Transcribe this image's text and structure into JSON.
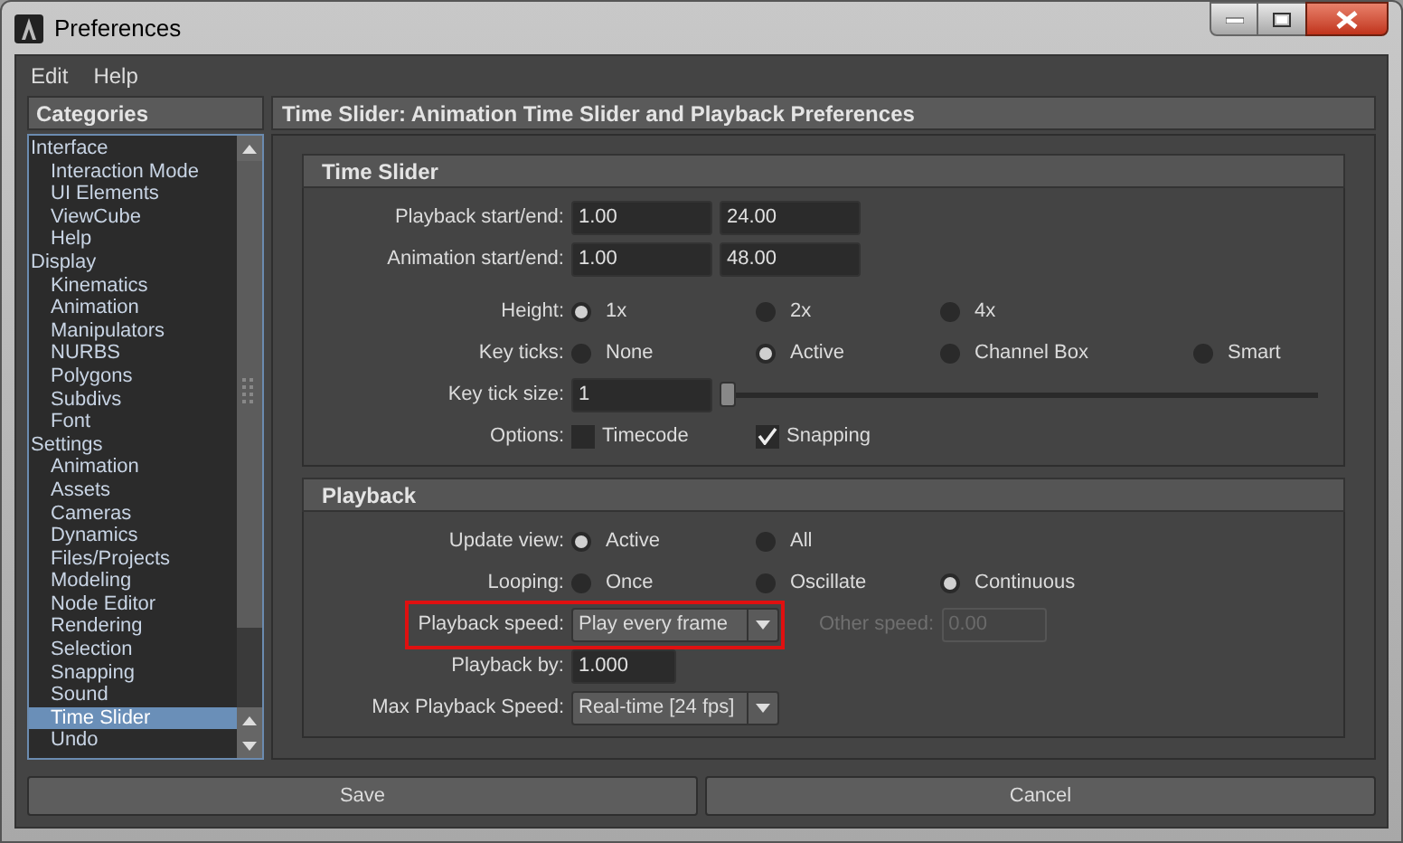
{
  "window": {
    "title": "Preferences"
  },
  "menu": [
    "Edit",
    "Help"
  ],
  "categories": {
    "title": "Categories",
    "items": [
      {
        "label": "Interface",
        "selected": false,
        "children": [
          {
            "label": "Interaction Mode",
            "selected": false
          },
          {
            "label": "UI Elements",
            "selected": false
          },
          {
            "label": "ViewCube",
            "selected": false
          },
          {
            "label": "Help",
            "selected": false
          }
        ]
      },
      {
        "label": "Display",
        "selected": false,
        "children": [
          {
            "label": "Kinematics",
            "selected": false
          },
          {
            "label": "Animation",
            "selected": false
          },
          {
            "label": "Manipulators",
            "selected": false
          },
          {
            "label": "NURBS",
            "selected": false
          },
          {
            "label": "Polygons",
            "selected": false
          },
          {
            "label": "Subdivs",
            "selected": false
          },
          {
            "label": "Font",
            "selected": false
          }
        ]
      },
      {
        "label": "Settings",
        "selected": false,
        "children": [
          {
            "label": "Animation",
            "selected": false
          },
          {
            "label": "Assets",
            "selected": false
          },
          {
            "label": "Cameras",
            "selected": false
          },
          {
            "label": "Dynamics",
            "selected": false
          },
          {
            "label": "Files/Projects",
            "selected": false
          },
          {
            "label": "Modeling",
            "selected": false
          },
          {
            "label": "Node Editor",
            "selected": false
          },
          {
            "label": "Rendering",
            "selected": false
          },
          {
            "label": "Selection",
            "selected": false
          },
          {
            "label": "Snapping",
            "selected": false
          },
          {
            "label": "Sound",
            "selected": false
          },
          {
            "label": "Time Slider",
            "selected": true
          },
          {
            "label": "Undo",
            "selected": false
          }
        ]
      }
    ]
  },
  "panel_title": "Time Slider: Animation Time Slider and Playback Preferences",
  "sections": [
    {
      "title": "Time Slider",
      "rows": [
        {
          "kind": "fields",
          "label": "Playback start/end:",
          "values": [
            "1.00",
            "24.00"
          ]
        },
        {
          "kind": "fields",
          "label": "Animation start/end:",
          "values": [
            "1.00",
            "48.00"
          ]
        },
        {
          "kind": "radio",
          "label": "Height:",
          "options": [
            {
              "label": "1x",
              "selected": true
            },
            {
              "label": "2x",
              "selected": false
            },
            {
              "label": "4x",
              "selected": false
            }
          ]
        },
        {
          "kind": "radio",
          "label": "Key ticks:",
          "options": [
            {
              "label": "None",
              "selected": false
            },
            {
              "label": "Active",
              "selected": true
            },
            {
              "label": "Channel Box",
              "selected": false
            },
            {
              "label": "Smart",
              "selected": false
            }
          ]
        },
        {
          "kind": "slider",
          "label": "Key tick size:",
          "value": "1",
          "level": 0
        },
        {
          "kind": "checks",
          "label": "Options:",
          "options": [
            {
              "label": "Timecode",
              "checked": false
            },
            {
              "label": "Snapping",
              "checked": true
            }
          ]
        }
      ]
    },
    {
      "title": "Playback",
      "rows": [
        {
          "kind": "radio",
          "label": "Update view:",
          "options": [
            {
              "label": "Active",
              "selected": true
            },
            {
              "label": "All",
              "selected": false
            }
          ]
        },
        {
          "kind": "radio",
          "label": "Looping:",
          "options": [
            {
              "label": "Once",
              "selected": false
            },
            {
              "label": "Oscillate",
              "selected": false
            },
            {
              "label": "Continuous",
              "selected": true
            }
          ]
        },
        {
          "kind": "dropdown",
          "label": "Playback speed:",
          "value": "Play every frame",
          "highlighted": true,
          "other": {
            "label": "Other speed:",
            "value": "0.00",
            "disabled": true
          }
        },
        {
          "kind": "field",
          "label": "Playback by:",
          "value": "1.000"
        },
        {
          "kind": "dropdown",
          "label": "Max Playback Speed:",
          "value": "Real-time [24 fps]",
          "highlighted": false
        }
      ]
    }
  ],
  "buttons": [
    "Save",
    "Cancel"
  ]
}
